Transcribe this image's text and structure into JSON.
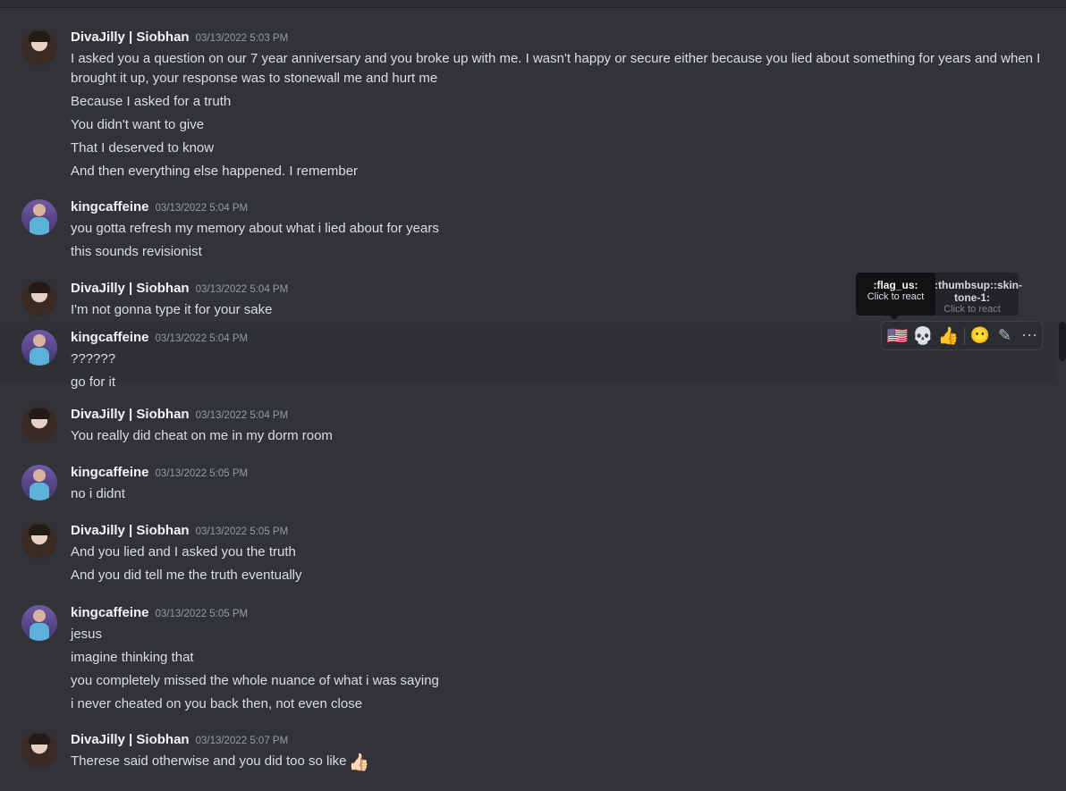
{
  "messages": [
    {
      "author": "DivaJilly | Siobhan",
      "time": "03/13/2022 5:03 PM",
      "avatar": "diva",
      "lines": [
        "I asked you a question on our 7 year anniversary and you broke up with me. I wasn't happy or secure either because you lied about something for years and when I brought it up, your response was to stonewall me and hurt me",
        "Because I asked for a truth",
        "You didn't want to give",
        "That I deserved to know",
        "And then everything else happened. I remember"
      ]
    },
    {
      "author": "kingcaffeine",
      "time": "03/13/2022 5:04 PM",
      "avatar": "king",
      "lines": [
        "you gotta refresh my memory about what i lied about for years",
        "this sounds revisionist"
      ]
    },
    {
      "author": "DivaJilly | Siobhan",
      "time": "03/13/2022 5:04 PM",
      "avatar": "diva",
      "lines": [
        "I'm not gonna type it for your sake"
      ]
    },
    {
      "author": "kingcaffeine",
      "time": "03/13/2022 5:04 PM",
      "avatar": "king",
      "lines": [
        "??????",
        "go for it"
      ]
    },
    {
      "author": "DivaJilly | Siobhan",
      "time": "03/13/2022 5:04 PM",
      "avatar": "diva",
      "lines": [
        "You really did cheat on me in my dorm room"
      ]
    },
    {
      "author": "kingcaffeine",
      "time": "03/13/2022 5:05 PM",
      "avatar": "king",
      "lines": [
        "no i didnt"
      ]
    },
    {
      "author": "DivaJilly | Siobhan",
      "time": "03/13/2022 5:05 PM",
      "avatar": "diva",
      "lines": [
        "And you lied and I asked you the truth",
        "And you did tell me the truth eventually"
      ]
    },
    {
      "author": "kingcaffeine",
      "time": "03/13/2022 5:05 PM",
      "avatar": "king",
      "lines": [
        "jesus",
        "imagine thinking that",
        "you completely missed the whole nuance of what i was saying",
        "i never cheated on you back then, not even close"
      ]
    },
    {
      "author": "DivaJilly | Siobhan",
      "time": "03/13/2022 5:07 PM",
      "avatar": "diva",
      "lines": [
        "Therese said otherwise and you did too so like"
      ]
    }
  ],
  "final_emoji": "👍🏻",
  "toolbar": {
    "flag": "🇺🇸",
    "skull": "💀",
    "thumb": "👍",
    "smile": "😶",
    "edit": "✎",
    "more": "⋯"
  },
  "tooltip": {
    "title": ":flag_us:",
    "subtitle": "Click to react",
    "back_title": ":thumbsup::skin-tone-1:",
    "back_subtitle": "Click to react"
  }
}
